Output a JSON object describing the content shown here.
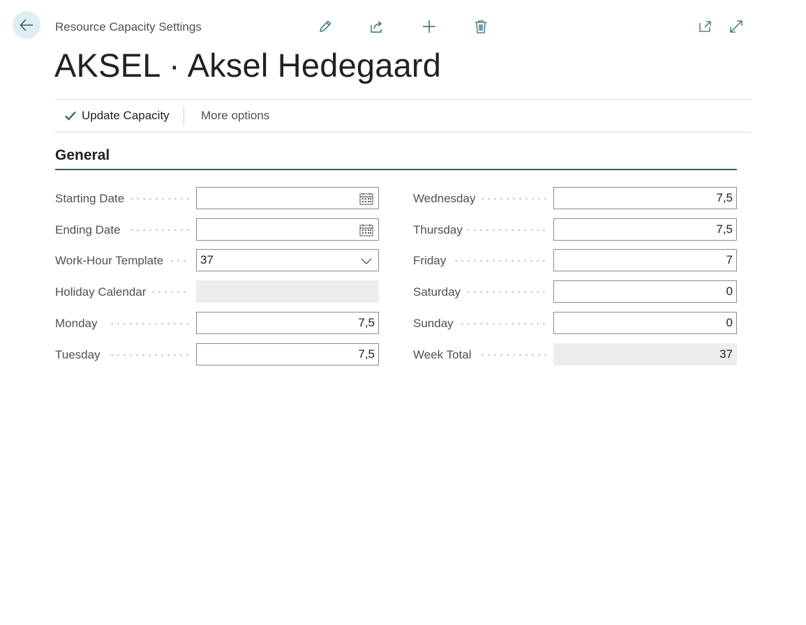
{
  "header": {
    "breadcrumb": "Resource Capacity Settings",
    "title": "AKSEL · Aksel Hedegaard"
  },
  "toolbar": {
    "icons": [
      "edit-icon",
      "share-icon",
      "add-icon",
      "delete-icon",
      "open-in-new-window-icon",
      "expand-icon"
    ]
  },
  "actions": {
    "update_capacity": "Update Capacity",
    "more_options": "More options"
  },
  "section": {
    "title": "General"
  },
  "fields_left": [
    {
      "label": "Starting Date",
      "value": "",
      "type": "date"
    },
    {
      "label": "Ending Date",
      "value": "",
      "type": "date"
    },
    {
      "label": "Work-Hour Template",
      "value": "37",
      "type": "select"
    },
    {
      "label": "Holiday Calendar",
      "value": "",
      "type": "readonly"
    },
    {
      "label": "Monday",
      "value": "7,5",
      "type": "number"
    },
    {
      "label": "Tuesday",
      "value": "7,5",
      "type": "number"
    }
  ],
  "fields_right": [
    {
      "label": "Wednesday",
      "value": "7,5",
      "type": "number"
    },
    {
      "label": "Thursday",
      "value": "7,5",
      "type": "number"
    },
    {
      "label": "Friday",
      "value": "7",
      "type": "number"
    },
    {
      "label": "Saturday",
      "value": "0",
      "type": "number"
    },
    {
      "label": "Sunday",
      "value": "0",
      "type": "number"
    },
    {
      "label": "Week Total",
      "value": "37",
      "type": "readonly-number"
    }
  ],
  "colors": {
    "accent": "#3d7a84",
    "back_button_bg": "#dfeff1",
    "readonly_bg": "#ededed"
  }
}
